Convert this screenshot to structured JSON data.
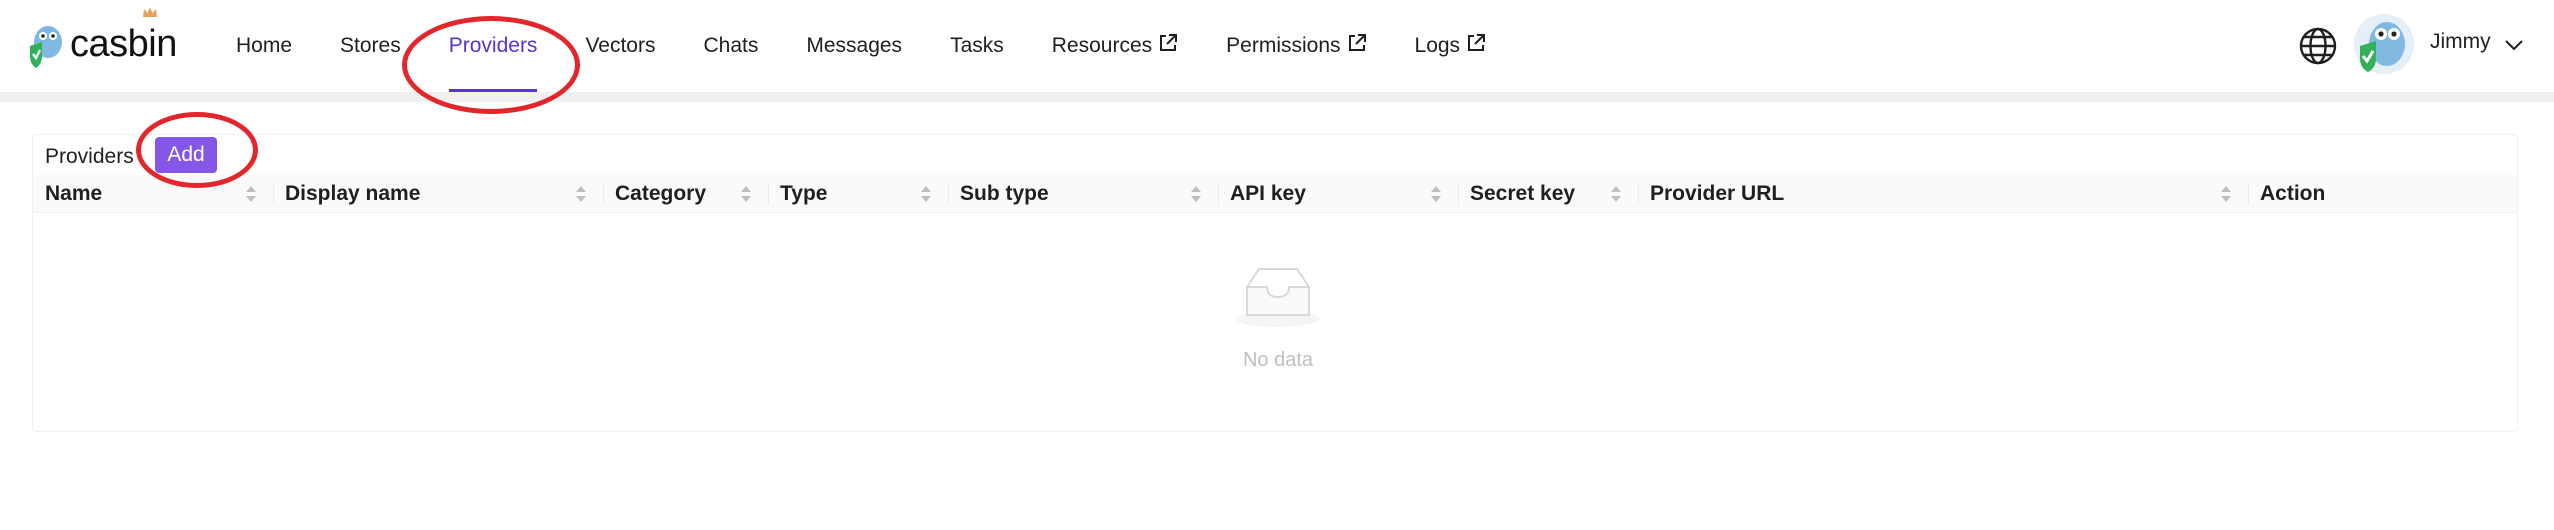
{
  "brand": {
    "name": "casbin"
  },
  "nav": {
    "items": [
      {
        "label": "Home"
      },
      {
        "label": "Stores"
      },
      {
        "label": "Providers",
        "active": true
      },
      {
        "label": "Vectors"
      },
      {
        "label": "Chats"
      },
      {
        "label": "Messages"
      },
      {
        "label": "Tasks"
      },
      {
        "label": "Resources",
        "external": true
      },
      {
        "label": "Permissions",
        "external": true
      },
      {
        "label": "Logs",
        "external": true
      }
    ]
  },
  "user": {
    "name": "Jimmy"
  },
  "providers": {
    "title": "Providers",
    "add_label": "Add",
    "columns": [
      "Name",
      "Display name",
      "Category",
      "Type",
      "Sub type",
      "API key",
      "Secret key",
      "Provider URL",
      "Action"
    ],
    "rows": [],
    "empty_text": "No data"
  },
  "colors": {
    "accent": "#5734d3",
    "button": "#8557e7",
    "annotation": "#e3262b"
  }
}
